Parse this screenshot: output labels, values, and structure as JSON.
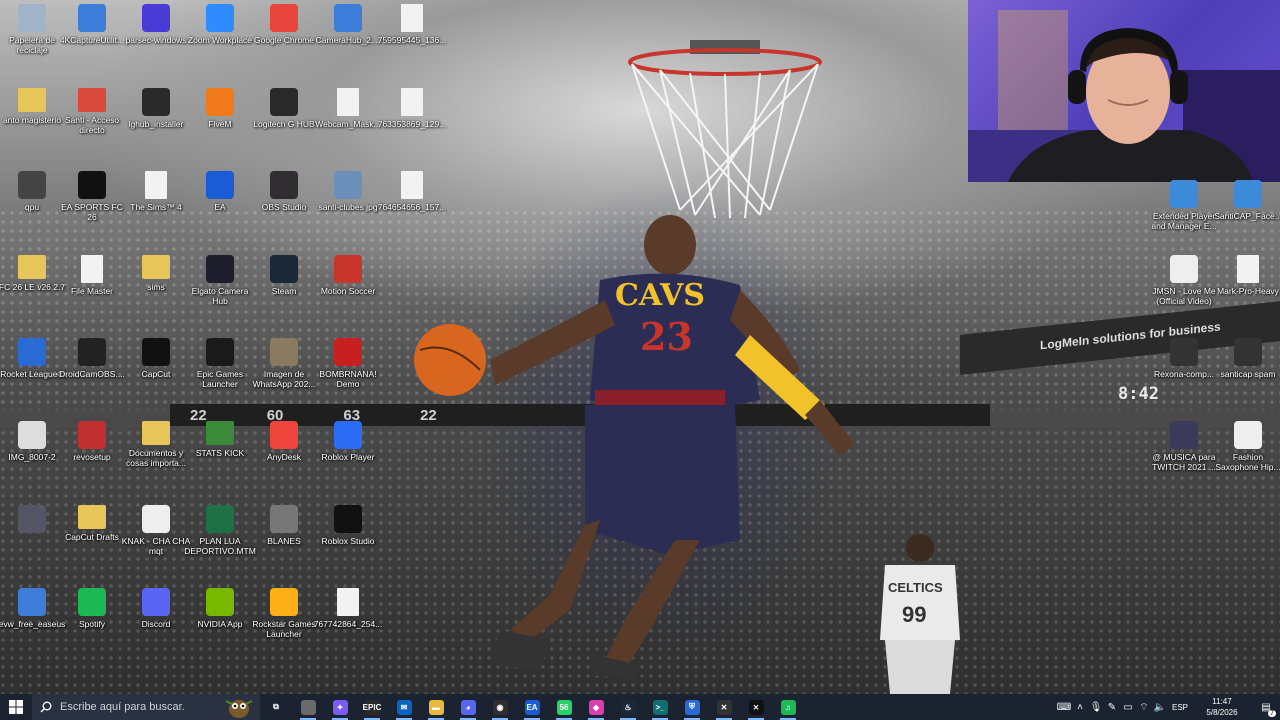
{
  "wallpaper": {
    "scoreboard": [
      "22",
      "60",
      "63",
      "22"
    ],
    "clock": "8:42",
    "jersey_number": "23",
    "jersey_team": "CAVS",
    "celtics_text": "CELTICS",
    "celtics_number": "99",
    "banner_text": "LogMeIn solutions for business"
  },
  "desktop_icons": [
    {
      "label": "Papelera de reciclaje",
      "icon": "recycle-bin-icon",
      "color": "#9fb4c8"
    },
    {
      "label": "4KCaptureUtilit...",
      "icon": "installer-icon",
      "color": "#3b7dd8"
    },
    {
      "label": "parsec-windows",
      "icon": "parsec-icon",
      "color": "#4b3bd6"
    },
    {
      "label": "Zoom Workplace",
      "icon": "zoom-icon",
      "color": "#2d8cff"
    },
    {
      "label": "Google Chrome",
      "icon": "chrome-icon",
      "color": "#e8453c"
    },
    {
      "label": "CameraHub_2....",
      "icon": "installer-icon",
      "color": "#3b7dd8"
    },
    {
      "label": "759595445_136...",
      "icon": "file-icon",
      "color": "#f2f2f2"
    },
    {
      "label": "anto magisterio",
      "icon": "folder-icon",
      "color": "#e8c55a"
    },
    {
      "label": "Santi - Acceso directo",
      "icon": "folder-icon",
      "color": "#d94a3a"
    },
    {
      "label": "lghub_installer",
      "icon": "logitech-icon",
      "color": "#2a2a2a"
    },
    {
      "label": "FiveM",
      "icon": "fivem-icon",
      "color": "#f07a1a"
    },
    {
      "label": "Logitech G HUB",
      "icon": "logitech-icon",
      "color": "#2a2a2a"
    },
    {
      "label": "Webcam_Mask...",
      "icon": "chrome-doc-icon",
      "color": "#f2f2f2"
    },
    {
      "label": "763353869_129...",
      "icon": "file-icon",
      "color": "#f2f2f2"
    },
    {
      "label": "qpu",
      "icon": "image-icon",
      "color": "#444"
    },
    {
      "label": "EA SPORTS FC 26",
      "icon": "fc26-icon",
      "color": "#111"
    },
    {
      "label": "The Sims™ 4",
      "icon": "file-icon",
      "color": "#f2f2f2"
    },
    {
      "label": "EA",
      "icon": "ea-icon",
      "color": "#1a5bd6"
    },
    {
      "label": "OBS Studio",
      "icon": "obs-icon",
      "color": "#302e31"
    },
    {
      "label": "santi-clubes.jpg",
      "icon": "image-icon",
      "color": "#6b8fb8"
    },
    {
      "label": "764654656_157...",
      "icon": "file-icon",
      "color": "#f2f2f2"
    },
    {
      "label": "FC 26 LE v26.2.7",
      "icon": "folder-icon",
      "color": "#e8c55a"
    },
    {
      "label": "File Master",
      "icon": "file-icon",
      "color": "#f2f2f2"
    },
    {
      "label": "sims",
      "icon": "folder-icon",
      "color": "#e8c55a"
    },
    {
      "label": "Elgato Camera Hub",
      "icon": "elgato-icon",
      "color": "#1d1d2b"
    },
    {
      "label": "Steam",
      "icon": "steam-icon",
      "color": "#1b2838"
    },
    {
      "label": "Motion Soccer",
      "icon": "motion-soccer-icon",
      "color": "#c8352a"
    },
    {
      "label": "Rocket League®",
      "icon": "rocket-league-icon",
      "color": "#2a6ad6"
    },
    {
      "label": "DroidCamOBS....",
      "icon": "droidcam-icon",
      "color": "#222"
    },
    {
      "label": "CapCut",
      "icon": "capcut-icon",
      "color": "#111"
    },
    {
      "label": "Epic Games Launcher",
      "icon": "epic-icon",
      "color": "#1a1a1a"
    },
    {
      "label": "Imagen de WhatsApp 202...",
      "icon": "image-icon",
      "color": "#8a7a60"
    },
    {
      "label": "BOMBRNANA! Demo",
      "icon": "bomb-icon",
      "color": "#c82020"
    },
    {
      "label": "IMG_8007-2",
      "icon": "image-icon",
      "color": "#ddd"
    },
    {
      "label": "revosetup",
      "icon": "revo-icon",
      "color": "#c03030"
    },
    {
      "label": "Documentos y cosas importa...",
      "icon": "folder-icon",
      "color": "#e8c55a"
    },
    {
      "label": "STATS KICK",
      "icon": "folder-icon",
      "color": "#3a8a3a"
    },
    {
      "label": "AnyDesk",
      "icon": "anydesk-icon",
      "color": "#ef443b"
    },
    {
      "label": "Roblox Player",
      "icon": "roblox-icon",
      "color": "#2a6df4"
    },
    {
      "label": "",
      "icon": "image-icon",
      "color": "#556"
    },
    {
      "label": "CapCut Drafts",
      "icon": "folder-icon",
      "color": "#e8c55a"
    },
    {
      "label": "KNAK - CHA CHA mqt",
      "icon": "video-icon",
      "color": "#eee"
    },
    {
      "label": "PLAN LUA DEPORTIVO.MTM",
      "icon": "excel-icon",
      "color": "#1e7145"
    },
    {
      "label": "BLANES",
      "icon": "image-icon",
      "color": "#777"
    },
    {
      "label": "Roblox Studio",
      "icon": "roblox-studio-icon",
      "color": "#111"
    },
    {
      "label": "evw_free_easeus",
      "icon": "installer-icon",
      "color": "#3b7dd8"
    },
    {
      "label": "Spotify",
      "icon": "spotify-icon",
      "color": "#1db954"
    },
    {
      "label": "Discord",
      "icon": "discord-icon",
      "color": "#5865f2"
    },
    {
      "label": "NVIDIA App",
      "icon": "nvidia-icon",
      "color": "#76b900"
    },
    {
      "label": "Rockstar Games Launcher",
      "icon": "rockstar-icon",
      "color": "#fcaf17"
    },
    {
      "label": "767742864_254...",
      "icon": "file-icon",
      "color": "#f2f2f2"
    }
  ],
  "right_icons": [
    {
      "label": "Extended Player and Manager E...",
      "icon": "app-icon",
      "color": "#3c8ad8"
    },
    {
      "label": "SantiCAP_Face...",
      "icon": "app-icon",
      "color": "#3c8ad8"
    },
    {
      "label": "JMSN - Love Me (Official Video)",
      "icon": "video-icon",
      "color": "#eee"
    },
    {
      "label": "Mark-Pro-Heavy",
      "icon": "font-icon",
      "color": "#f2f2f2"
    },
    {
      "label": "Rexona-comp...",
      "icon": "image-icon",
      "color": "#333"
    },
    {
      "label": "santicap spam",
      "icon": "image-icon",
      "color": "#333"
    },
    {
      "label": "@ MUSICA para TWITCH 2021 ...",
      "icon": "image-icon",
      "color": "#3a3a5a"
    },
    {
      "label": "Fashion Saxophone Hip...",
      "icon": "video-icon",
      "color": "#eee"
    }
  ],
  "taskbar": {
    "search_placeholder": "Escribe aquí para buscar.",
    "apps": [
      {
        "name": "task-view",
        "glyph": "⧉",
        "color": "transparent"
      },
      {
        "name": "file-explorer-pinned",
        "glyph": "",
        "color": "#6a6a6a"
      },
      {
        "name": "copilot",
        "glyph": "✦",
        "color": "#7a5af8"
      },
      {
        "name": "epic-games",
        "glyph": "EPIC",
        "color": "#2a2a2a"
      },
      {
        "name": "outlook",
        "glyph": "✉",
        "color": "#0a64c8"
      },
      {
        "name": "file-explorer",
        "glyph": "▬",
        "color": "#e8b93a"
      },
      {
        "name": "discord",
        "glyph": "◕",
        "color": "#5865f2"
      },
      {
        "name": "obs",
        "glyph": "◉",
        "color": "#302e31"
      },
      {
        "name": "ea",
        "glyph": "EA",
        "color": "#1a5bd6"
      },
      {
        "name": "whatsapp",
        "glyph": "56",
        "color": "#25d366"
      },
      {
        "name": "parsec",
        "glyph": "◆",
        "color": "#d93fae"
      },
      {
        "name": "steam",
        "glyph": "♨",
        "color": "#1b2838"
      },
      {
        "name": "terminal",
        "glyph": ">_",
        "color": "#0f6e6e"
      },
      {
        "name": "rocket-league",
        "glyph": "⛨",
        "color": "#2a6ad6"
      },
      {
        "name": "razer",
        "glyph": "✕",
        "color": "#333"
      },
      {
        "name": "capcut",
        "glyph": "⨯",
        "color": "#111"
      },
      {
        "name": "spotify",
        "glyph": "♫",
        "color": "#1db954"
      }
    ],
    "language": "ESP",
    "time": "11:47",
    "date": "5/8/2026",
    "notification_count": "7"
  }
}
